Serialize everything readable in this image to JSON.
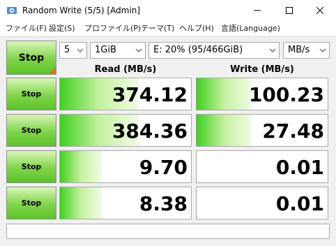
{
  "window": {
    "title": "Random Write (5/5) [Admin]"
  },
  "menu": [
    {
      "label": "ファイル(F)"
    },
    {
      "label": "設定(S)"
    },
    {
      "label": "プロファイル(P)"
    },
    {
      "label": "テーマ(T)"
    },
    {
      "label": "ヘルプ(H)"
    },
    {
      "label": "言語(Language)"
    }
  ],
  "controls": {
    "main_button": "Stop",
    "count": "5",
    "size": "1GiB",
    "drive": "E: 20% (95/466GiB)",
    "unit": "MB/s"
  },
  "headers": {
    "read": "Read (MB/s)",
    "write": "Write (MB/s)"
  },
  "rows": [
    {
      "button": "Stop",
      "read": "374.12",
      "write": "100.23",
      "read_fill": 0.6,
      "write_fill": 0.42
    },
    {
      "button": "Stop",
      "read": "384.36",
      "write": "27.48",
      "read_fill": 0.6,
      "write_fill": 0.42
    },
    {
      "button": "Stop",
      "read": "9.70",
      "write": "0.01",
      "read_fill": 0.32,
      "write_fill": 0.0
    },
    {
      "button": "Stop",
      "read": "8.38",
      "write": "0.01",
      "read_fill": 0.32,
      "write_fill": 0.0
    }
  ],
  "status_text": "",
  "colors": {
    "button_green": "#5cc22a",
    "bar_green": "#3fd01f",
    "corner_orange": "#e07010"
  },
  "icons": [
    "app-icon",
    "minimize-icon",
    "maximize-icon",
    "close-icon",
    "chevron-down-icon"
  ]
}
